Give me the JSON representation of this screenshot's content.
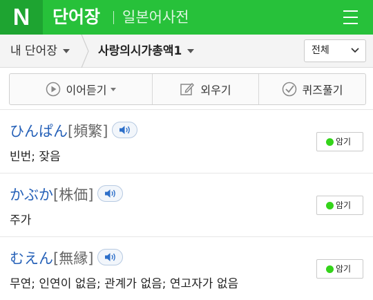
{
  "header": {
    "logo": "N",
    "title": "단어장",
    "subtitle": "일본어사전",
    "menu_icon": "hamburger-menu-icon",
    "bg_color": "#27c13a"
  },
  "breadcrumb": {
    "root": "내 단어장",
    "current": "사랑의시가총액1",
    "filter": "전체"
  },
  "toolbar": {
    "continuous_listen": "이어듣기",
    "memorize": "외우기",
    "quiz": "퀴즈풀기"
  },
  "words": [
    {
      "kana": "ひんぱん",
      "kanji": "[頻繁]",
      "meaning": "빈번; 잦음",
      "memorize_label": "암기"
    },
    {
      "kana": "かぶか",
      "kanji": "[株価]",
      "meaning": "주가",
      "memorize_label": "암기"
    },
    {
      "kana": "むえん",
      "kanji": "[無縁]",
      "meaning": "무연; 인연이 없음; 관계가 없음; 연고자가 없음",
      "memorize_label": "암기"
    }
  ],
  "colors": {
    "kana": "#2661b8",
    "memorize_dot": "#34d41a"
  }
}
